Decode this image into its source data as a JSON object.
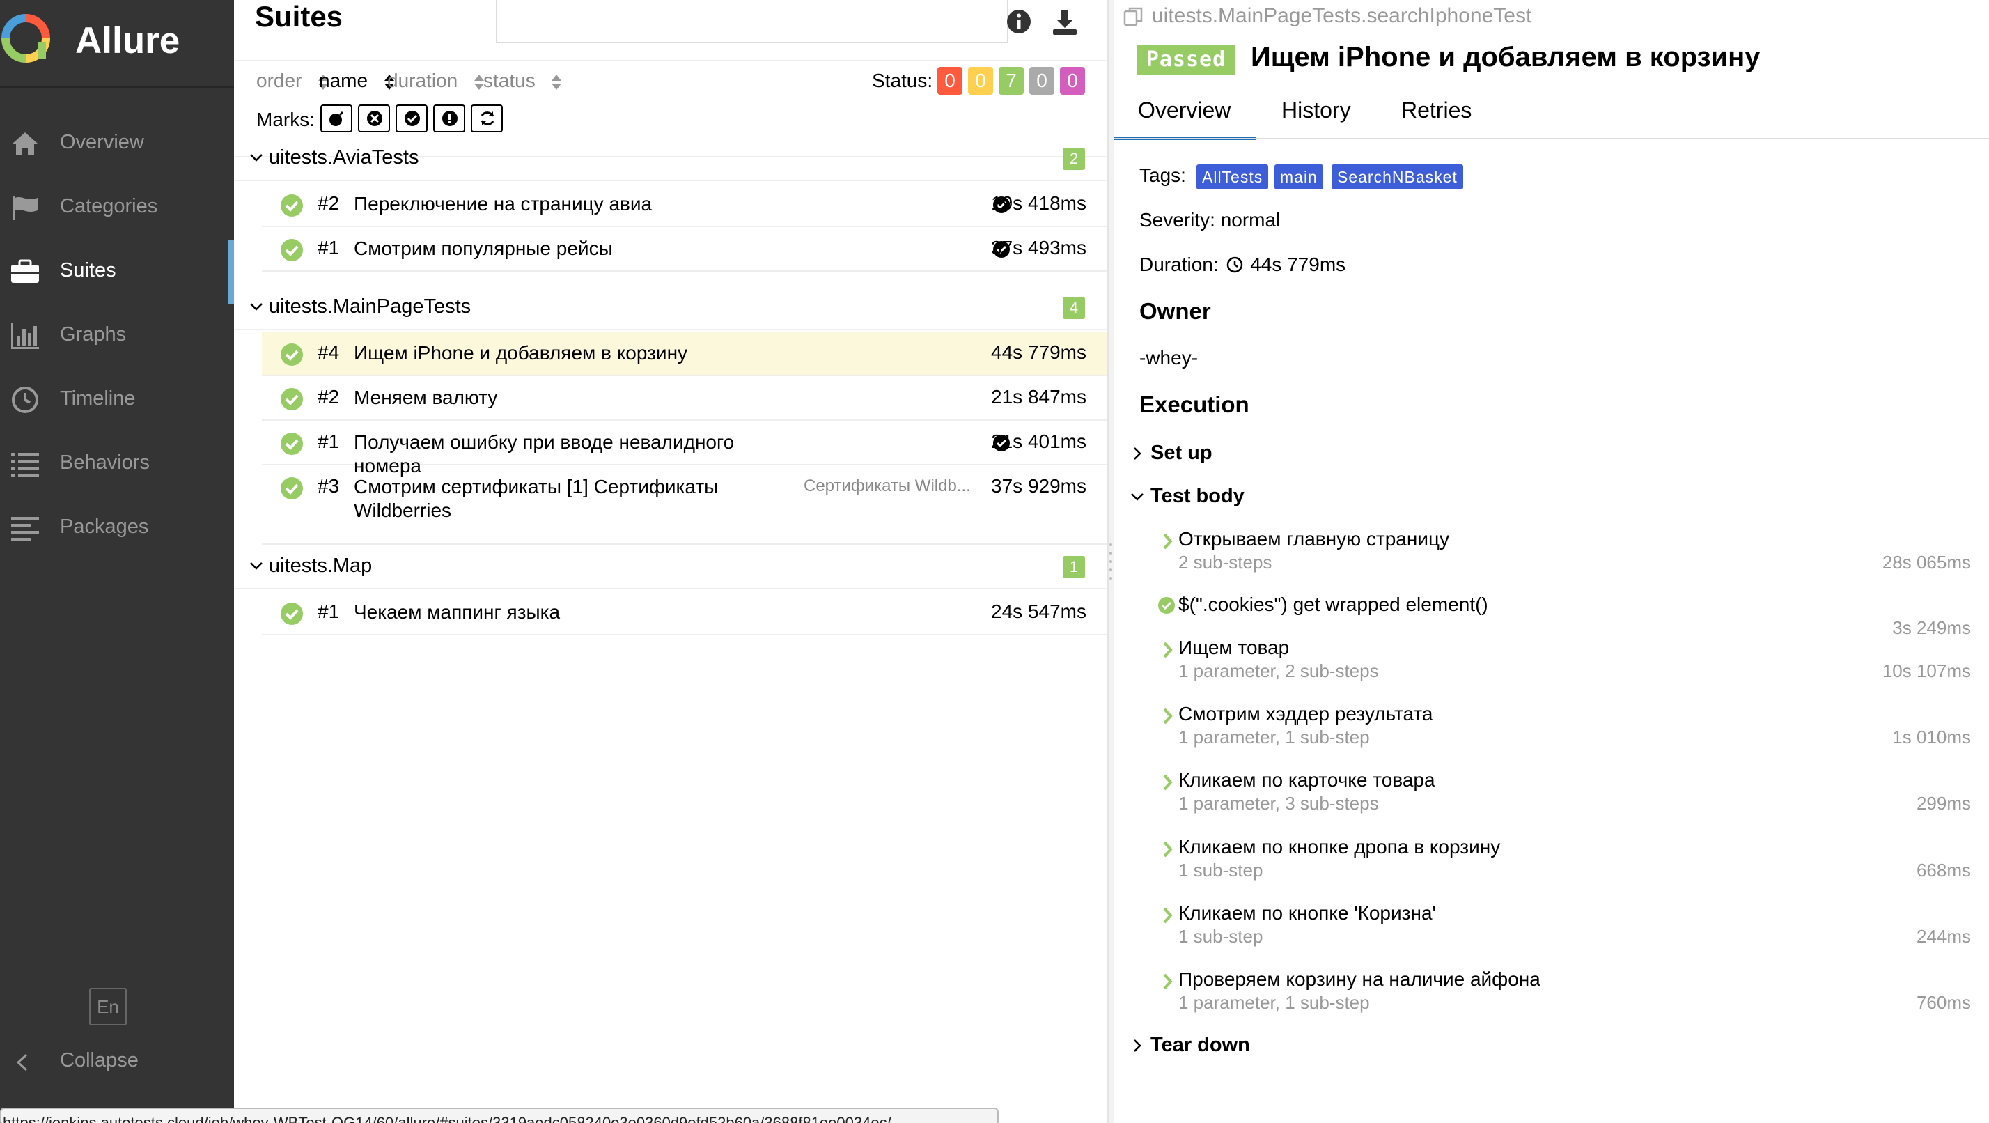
{
  "app": {
    "name": "Allure"
  },
  "sidebar": {
    "items": [
      {
        "label": "Overview",
        "icon": "home-icon"
      },
      {
        "label": "Categories",
        "icon": "flag-icon"
      },
      {
        "label": "Suites",
        "icon": "briefcase-icon",
        "active": true
      },
      {
        "label": "Graphs",
        "icon": "bar-chart-icon"
      },
      {
        "label": "Timeline",
        "icon": "clock-icon"
      },
      {
        "label": "Behaviors",
        "icon": "list-icon"
      },
      {
        "label": "Packages",
        "icon": "align-left-icon"
      }
    ],
    "language": "En",
    "collapse_label": "Collapse"
  },
  "suites": {
    "title": "Suites",
    "search_value": "",
    "sort": {
      "order": "order",
      "name": "name",
      "duration": "duration",
      "status": "status",
      "active": "name"
    },
    "status_label": "Status:",
    "status_counts": [
      {
        "value": "0",
        "color": "#fd5a3e",
        "meaning": "failed"
      },
      {
        "value": "0",
        "color": "#ffd050",
        "meaning": "broken"
      },
      {
        "value": "7",
        "color": "#97cc64",
        "meaning": "passed"
      },
      {
        "value": "0",
        "color": "#aaaaaa",
        "meaning": "skipped"
      },
      {
        "value": "0",
        "color": "#d35ebe",
        "meaning": "unknown"
      }
    ],
    "marks_label": "Marks:",
    "groups": [
      {
        "name": "uitests.AviaTests",
        "count": "2",
        "tests": [
          {
            "num": "#2",
            "name": "Переключение на страницу авиа",
            "duration": "19s 418ms",
            "flaky": true
          },
          {
            "num": "#1",
            "name": "Смотрим популярные рейсы",
            "duration": "37s 493ms",
            "flaky": true
          }
        ]
      },
      {
        "name": "uitests.MainPageTests",
        "count": "4",
        "tests": [
          {
            "num": "#4",
            "name": "Ищем iPhone и добавляем в корзину",
            "duration": "44s 779ms",
            "selected": true
          },
          {
            "num": "#2",
            "name": "Меняем валюту",
            "duration": "21s 847ms"
          },
          {
            "num": "#1",
            "name": "Получаем ошибку при вводе невалидного номера",
            "duration": "21s 401ms",
            "flaky": true
          },
          {
            "num": "#3",
            "name": "Смотрим сертификаты [1] Сертификаты Wildberries",
            "param": "Сертификаты Wildb...",
            "duration": "37s 929ms"
          }
        ]
      },
      {
        "name": "uitests.Map",
        "count": "1",
        "tests": [
          {
            "num": "#1",
            "name": "Чекаем маппинг языка",
            "duration": "24s 547ms"
          }
        ]
      }
    ],
    "status_url": "https://jenkins.autotests.cloud/job/whey-WBTest-QG14/60/allure/#suites/3319aedc058240e3e0360d9efd52b60a/3688f81ee0034ec/"
  },
  "detail": {
    "breadcrumb": "uitests.MainPageTests.searchIphoneTest",
    "status": "Passed",
    "title": "Ищем iPhone и добавляем в корзину",
    "tabs": [
      "Overview",
      "History",
      "Retries"
    ],
    "active_tab": "Overview",
    "tags_label": "Tags:",
    "tags": [
      "AllTests",
      "main",
      "SearchNBasket"
    ],
    "severity": "Severity: normal",
    "duration_label": "Duration:",
    "duration": "44s 779ms",
    "owner_heading": "Owner",
    "owner": "-whey-",
    "execution_heading": "Execution",
    "setup_label": "Set up",
    "testbody_label": "Test body",
    "teardown_label": "Tear down",
    "steps": [
      {
        "name": "Открываем главную страницу",
        "sub": "2 sub-steps",
        "duration": "28s 065ms",
        "type": "expandable"
      },
      {
        "name": "$(\".cookies\") get wrapped element()",
        "sub": "",
        "duration": "3s 249ms",
        "type": "passed"
      },
      {
        "name": "Ищем товар",
        "sub": "1 parameter, 2 sub-steps",
        "duration": "10s 107ms",
        "type": "expandable"
      },
      {
        "name": "Смотрим хэддер результата",
        "sub": "1 parameter, 1 sub-step",
        "duration": "1s 010ms",
        "type": "expandable"
      },
      {
        "name": "Кликаем по карточке товара",
        "sub": "1 parameter, 3 sub-steps",
        "duration": "299ms",
        "type": "expandable"
      },
      {
        "name": "Кликаем по кнопке дропа в корзину",
        "sub": "1 sub-step",
        "duration": "668ms",
        "type": "expandable"
      },
      {
        "name": "Кликаем по кнопке 'Коризна'",
        "sub": "1 sub-step",
        "duration": "244ms",
        "type": "expandable"
      },
      {
        "name": "Проверяем корзину на наличие айфона",
        "sub": "1 parameter, 1 sub-step",
        "duration": "760ms",
        "type": "expandable"
      }
    ]
  },
  "colors": {
    "passed": "#97cc64",
    "accent": "#1d6fb8",
    "tag": "#3d5ed8",
    "sidebar": "#343434",
    "selected_row": "#fcf8dc"
  }
}
